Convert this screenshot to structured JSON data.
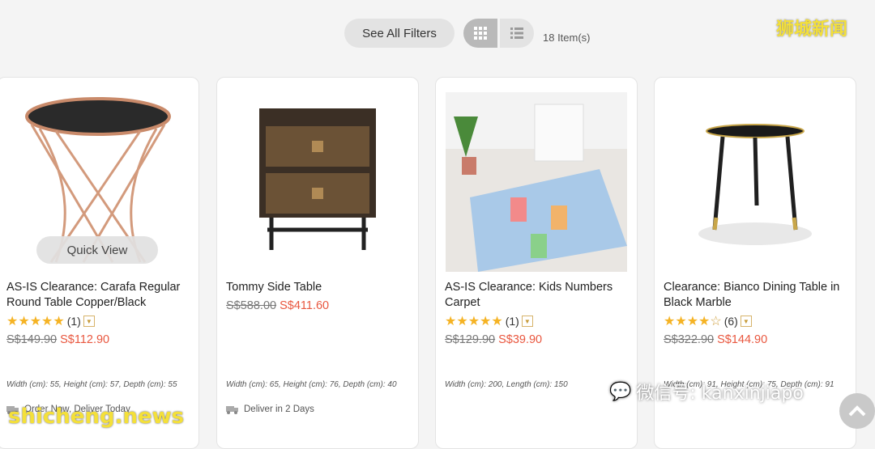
{
  "toolbar": {
    "filters_label": "See All Filters",
    "item_count": "18 Item(s)"
  },
  "watermarks": {
    "top_right": "狮城新闻",
    "bottom_left": "shicheng.news",
    "bottom_right": "微信号: kanxinjiapo"
  },
  "colors": {
    "sale_price": "#e9573f",
    "star": "#f5b324"
  },
  "products": [
    {
      "title": "AS-IS Clearance: Carafa Regular Round Table Copper/Black",
      "rating_count": "(1)",
      "rating": 5,
      "old_price": "S$149.90",
      "new_price": "S$112.90",
      "dimensions": "Width (cm): 55, Height (cm): 57, Depth (cm): 55",
      "delivery": "Order Now, Deliver Today",
      "quick_view": "Quick View"
    },
    {
      "title": "Tommy Side Table",
      "old_price": "S$588.00",
      "new_price": "S$411.60",
      "dimensions": "Width (cm): 65, Height (cm): 76, Depth (cm): 40",
      "delivery": "Deliver in 2 Days"
    },
    {
      "title": "AS-IS Clearance: Kids Numbers Carpet",
      "rating_count": "(1)",
      "rating": 5,
      "old_price": "S$129.90",
      "new_price": "S$39.90",
      "dimensions": "Width (cm): 200, Length (cm): 150"
    },
    {
      "title": "Clearance: Bianco Dining Table in Black Marble",
      "rating_count": "(6)",
      "rating": 4,
      "old_price": "S$322.90",
      "new_price": "S$144.90",
      "dimensions": "Width (cm): 91, Height (cm): 75, Depth (cm): 91"
    }
  ]
}
